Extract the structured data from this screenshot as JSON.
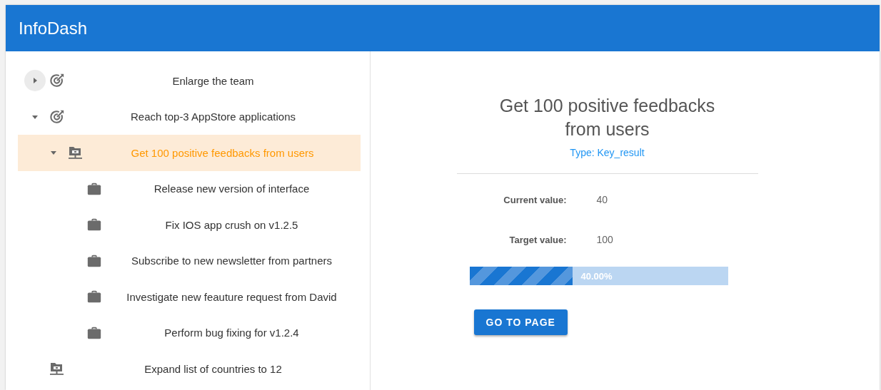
{
  "app": {
    "title": "InfoDash"
  },
  "tree": [
    {
      "label": "Enlarge the team",
      "kind": "goal",
      "expanded": false,
      "selected": false,
      "hovered": true
    },
    {
      "label": "Reach top-3 AppStore applications",
      "kind": "goal",
      "expanded": true,
      "selected": false,
      "children": [
        {
          "label": "Get 100 positive feedbacks from users",
          "kind": "key_result",
          "expanded": true,
          "selected": true,
          "children": [
            {
              "label": "Release new version of interface",
              "kind": "task",
              "selected": false
            },
            {
              "label": "Fix IOS app crush on v1.2.5",
              "kind": "task",
              "selected": false
            },
            {
              "label": "Subscribe to new newsletter from partners",
              "kind": "task",
              "selected": false
            },
            {
              "label": "Investigate new feauture request from David",
              "kind": "task",
              "selected": false
            },
            {
              "label": "Perform bug fixing for v1.2.4",
              "kind": "task",
              "selected": false
            }
          ]
        }
      ]
    },
    {
      "label": "Expand list of countries to 12",
      "kind": "key_result",
      "selected": false
    }
  ],
  "detail": {
    "title": "Get 100 positive feedbacks from users",
    "type": "Type: Key_result",
    "fields": [
      {
        "label": "Current value:",
        "value": "40"
      },
      {
        "label": "Target value:",
        "value": "100"
      }
    ],
    "progress": {
      "level": 0.4,
      "label": "40.00%"
    },
    "button": "GO TO PAGE"
  }
}
